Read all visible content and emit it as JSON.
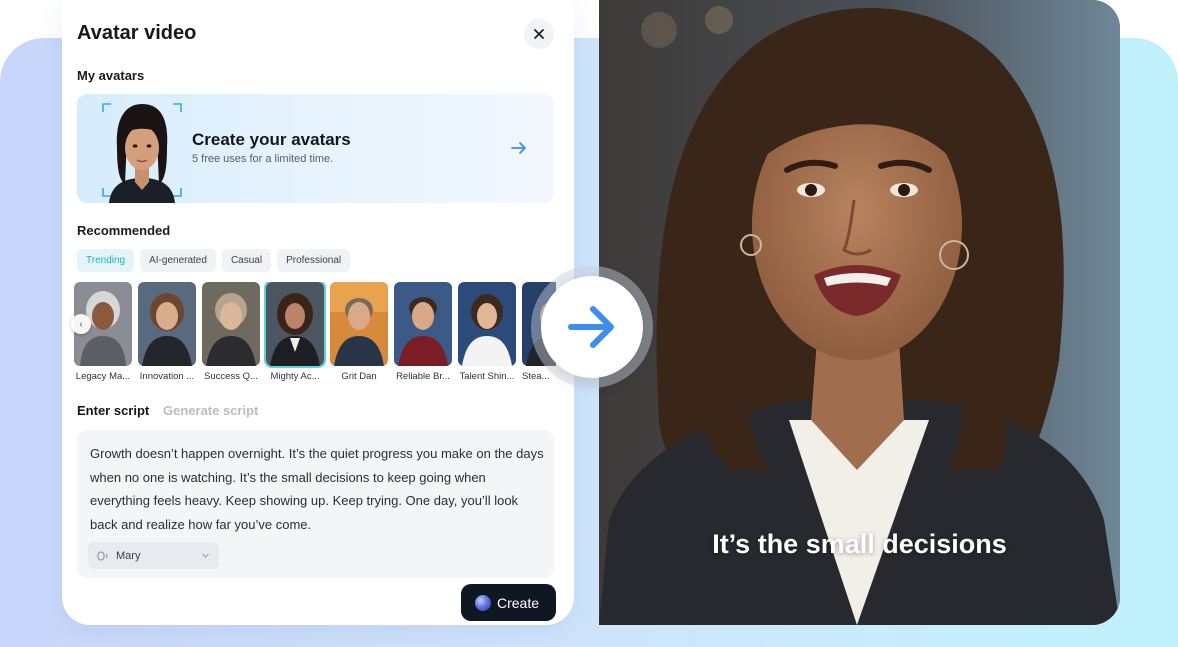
{
  "panel": {
    "title": "Avatar video",
    "close_icon": "close-icon"
  },
  "my_avatars": {
    "label": "My avatars",
    "card_title": "Create your avatars",
    "card_subtitle": "5 free uses for a limited time.",
    "card_icon": "arrow-right-icon"
  },
  "recommended": {
    "label": "Recommended",
    "chips": [
      "Trending",
      "AI-generated",
      "Casual",
      "Professional"
    ],
    "active_chip": "Trending",
    "avatars": [
      {
        "name": "Legacy Ma..."
      },
      {
        "name": "Innovation ..."
      },
      {
        "name": "Success Q..."
      },
      {
        "name": "Mighty Ac...",
        "selected": true
      },
      {
        "name": "Grit Dan"
      },
      {
        "name": "Reliable Br..."
      },
      {
        "name": "Talent Shin..."
      },
      {
        "name": "Stea..."
      }
    ]
  },
  "script": {
    "tab_enter": "Enter script",
    "tab_generate": "Generate script",
    "text": "Growth doesn’t happen overnight. It’s the quiet progress you make on the days when no one is watching. It’s the small decisions to keep going when everything feels heavy. Keep showing up. Keep trying. One day, you’ll look back and realize how far you’ve come.",
    "voice": "Mary"
  },
  "create_button": "Create",
  "video": {
    "subtitle": "It’s the small decisions"
  },
  "colors": {
    "accent": "#1fb3c2",
    "arrow_blue": "#3b8ef0",
    "button_dark": "#0f1722"
  }
}
